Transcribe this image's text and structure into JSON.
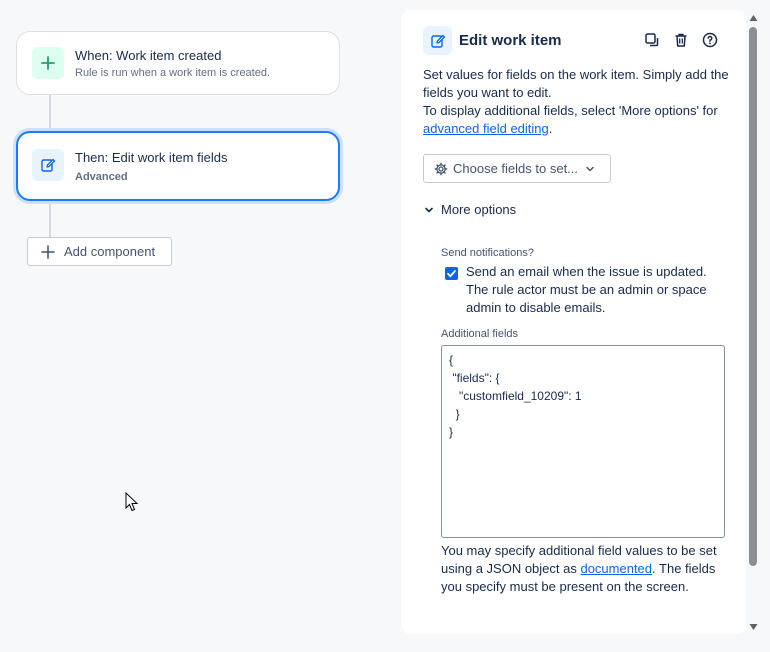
{
  "canvas": {
    "trigger": {
      "title": "When: Work item created",
      "subtitle": "Rule is run when a work item is created.",
      "icon": "plus-icon",
      "icon_bg": "#dcfff1",
      "icon_color": "#22a06b"
    },
    "action": {
      "title": "Then: Edit work item fields",
      "subtitle": "Advanced",
      "icon": "edit-icon",
      "icon_bg": "#e9f2ff",
      "icon_color": "#0c66e4"
    },
    "add_component_label": "Add component"
  },
  "panel": {
    "title": "Edit work item",
    "header_icons": [
      "copy-icon",
      "trash-icon",
      "help-icon"
    ],
    "description_line1": "Set values for fields on the work item. Simply add the fields you want to edit.",
    "description_line2_prefix": "To display additional fields, select 'More options' for ",
    "description_link": "advanced field editing",
    "description_line2_suffix": ".",
    "choose_fields_label": "Choose fields to set...",
    "more_options_label": "More options",
    "send_notifications_label": "Send notifications?",
    "send_email_checked": true,
    "send_email_text": "Send an email when the issue is updated. The rule actor must be an admin or space admin to disable emails.",
    "additional_fields_label": "Additional fields",
    "additional_fields_value": "{\n \"fields\": {\n   \"customfield_10209\": 1\n  }\n}",
    "help_prefix": "You may specify additional field values to be set using a JSON object as ",
    "help_link": "documented",
    "help_suffix": ". The fields you specify must be present on the screen."
  },
  "colors": {
    "accent": "#0c66e4",
    "selected_border": "#1d7afc",
    "background": "#f7f8f9"
  }
}
